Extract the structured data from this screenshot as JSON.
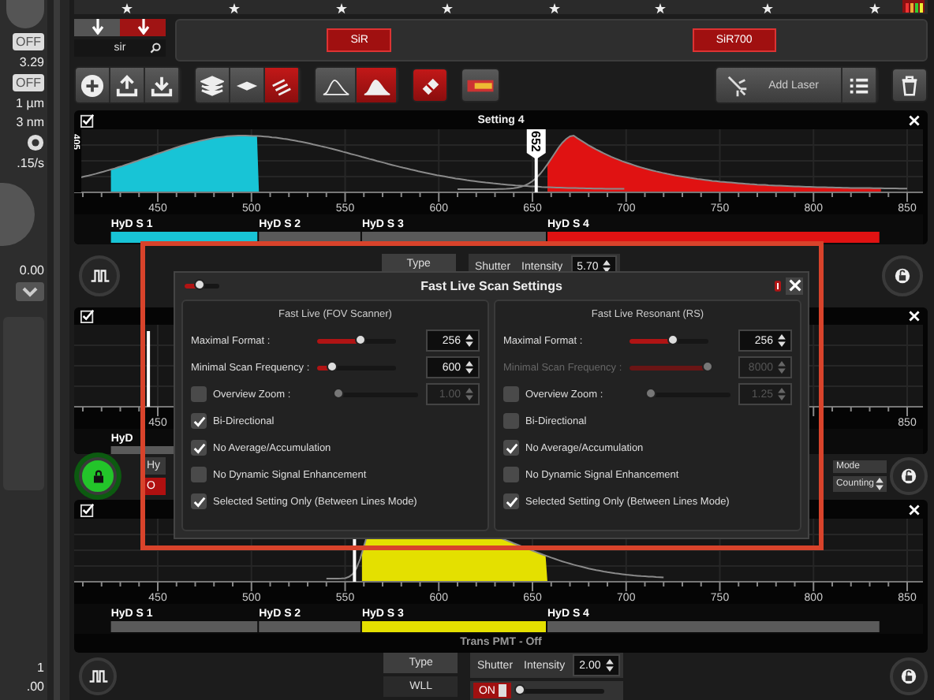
{
  "sidebar": {
    "top_items": [
      {
        "kind": "toggle",
        "label": "OFF"
      },
      {
        "kind": "value",
        "label": "3.29"
      },
      {
        "kind": "toggle",
        "label": "OFF"
      },
      {
        "kind": "value",
        "label": "1 µm"
      },
      {
        "kind": "value",
        "label": "3 nm"
      },
      {
        "kind": "icon"
      },
      {
        "kind": "value",
        "label": ".15/s"
      }
    ],
    "middle_items": [
      {
        "kind": "value",
        "label": "0.00"
      },
      {
        "kind": "icon"
      }
    ],
    "bottom_items": [
      {
        "kind": "value",
        "label": "1"
      },
      {
        "kind": "value",
        "label": ".00"
      }
    ]
  },
  "dyes": {
    "filter_buttons": [
      {
        "selected": false
      },
      {
        "selected": true
      }
    ],
    "search": {
      "value": "sir"
    },
    "chips": [
      "SiR",
      "SiR700"
    ]
  },
  "toolbar": {
    "view_buttons": [
      {
        "selected": false
      },
      {
        "selected": false
      },
      {
        "selected": true
      }
    ],
    "spectrum_buttons": [
      {
        "selected": false
      },
      {
        "selected": true
      }
    ],
    "add_laser": "Add Laser"
  },
  "spectra": [
    {
      "title": "Setting 4",
      "laser_labels": [
        "405",
        "652"
      ],
      "ticks": [
        "450",
        "500",
        "550",
        "600",
        "650",
        "700",
        "750",
        "800",
        "850"
      ],
      "detectors": [
        {
          "label": "HyD S 1",
          "color": "#18c4d6"
        },
        {
          "label": "HyD S 2",
          "color": "#5a5a5a"
        },
        {
          "label": "HyD S 3",
          "color": "#5a5a5a"
        },
        {
          "label": "HyD S 4",
          "color": "#e01212"
        }
      ]
    },
    {
      "ticks": [
        "450",
        "850"
      ],
      "detectors": [
        {
          "label": "HyD",
          "color": "#5a5a5a"
        }
      ]
    },
    {
      "ticks": [
        "450",
        "500",
        "550",
        "600",
        "650",
        "700",
        "750",
        "800",
        "850"
      ],
      "detectors": [
        {
          "label": "HyD S 1",
          "color": "#5a5a5a"
        },
        {
          "label": "HyD S 2",
          "color": "#5a5a5a"
        },
        {
          "label": "HyD S 3",
          "color": "#e4e000"
        },
        {
          "label": "HyD S 4",
          "color": "#5a5a5a"
        }
      ],
      "footer": "Trans PMT - Off"
    }
  ],
  "controls": [
    {
      "type_label": "Type",
      "shutter_label": "Shutter",
      "intensity_label": "Intensity",
      "intensity": "5.70"
    },
    {
      "left_labels": [
        "Hy",
        "O"
      ],
      "right_labels": [
        "Mode",
        "Counting"
      ]
    },
    {
      "type_label": "Type",
      "type_value": "WLL",
      "shutter_label": "Shutter",
      "shutter": {
        "label": "ON",
        "on": true
      },
      "intensity_label": "Intensity",
      "intensity": "2.00",
      "level": 0.05
    }
  ],
  "dialog": {
    "title": "Fast Live Scan Settings",
    "opacity": {
      "level": 0.45
    },
    "columns": [
      {
        "title": "Fast Live (FOV Scanner)",
        "rows": [
          {
            "kind": "slider",
            "label": "Maximal Format :",
            "level": 0.55,
            "value": "256",
            "disabled": false
          },
          {
            "kind": "slider",
            "label": "Minimal Scan Frequency :",
            "level": 0.2,
            "value": "600",
            "disabled": false
          },
          {
            "kind": "check-slider",
            "label": "Overview Zoom :",
            "checked": false,
            "level": 0,
            "value": "1.00",
            "disabled": true
          },
          {
            "kind": "checkbox",
            "label": "Bi-Directional",
            "checked": true
          },
          {
            "kind": "checkbox",
            "label": "No Average/Accumulation",
            "checked": true
          },
          {
            "kind": "checkbox",
            "label": "No Dynamic Signal Enhancement",
            "checked": false
          },
          {
            "kind": "checkbox",
            "label": "Selected Setting Only (Between Lines Mode)",
            "checked": true
          }
        ]
      },
      {
        "title": "Fast Live Resonant (RS)",
        "rows": [
          {
            "kind": "slider",
            "label": "Maximal Format :",
            "level": 0.55,
            "value": "256",
            "disabled": false
          },
          {
            "kind": "slider",
            "label": "Minimal Scan Frequency :",
            "level": 1,
            "value": "8000",
            "disabled": true
          },
          {
            "kind": "check-slider",
            "label": "Overview Zoom :",
            "checked": false,
            "level": 0,
            "value": "1.25",
            "disabled": true
          },
          {
            "kind": "checkbox",
            "label": "Bi-Directional",
            "checked": false
          },
          {
            "kind": "checkbox",
            "label": "No Average/Accumulation",
            "checked": true
          },
          {
            "kind": "checkbox",
            "label": "No Dynamic Signal Enhancement",
            "checked": false
          },
          {
            "kind": "checkbox",
            "label": "Selected Setting Only (Between Lines Mode)",
            "checked": true
          }
        ]
      }
    ]
  }
}
